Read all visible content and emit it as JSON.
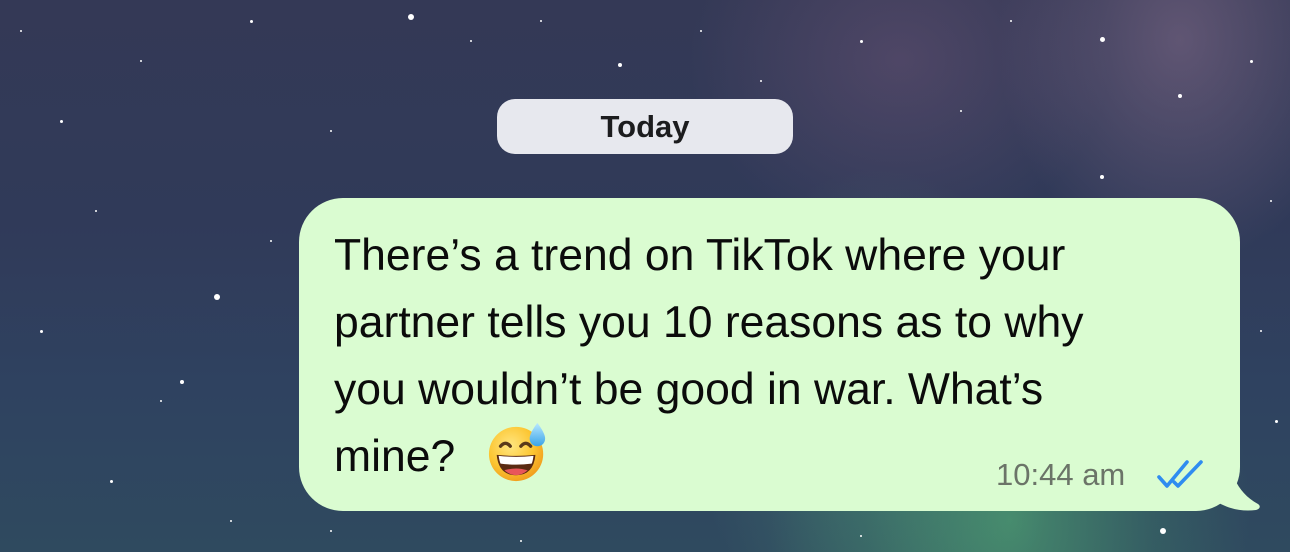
{
  "chat": {
    "date_separator": "Today",
    "messages": [
      {
        "direction": "outgoing",
        "text": "There’s a trend on TikTok where your\npartner tells you 10 reasons as to why\nyou wouldn’t be good in war. What’s\nmine?",
        "emoji_icon": "grinning-face-with-sweat-icon",
        "time": "10:44 am",
        "status_icon": "double-check-read-icon",
        "status": "read"
      }
    ]
  },
  "colors": {
    "outgoing_bubble": "#dafcd1",
    "date_pill": "#e7e8ee",
    "read_ticks": "#2f8cf0",
    "timestamp": "#6b7468"
  }
}
